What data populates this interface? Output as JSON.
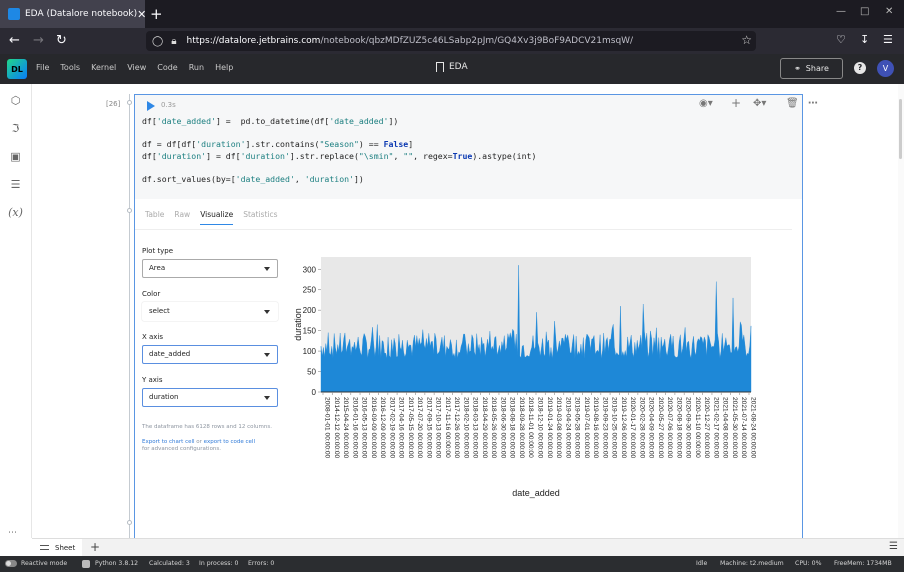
{
  "browser": {
    "tab_title": "EDA (Datalore notebook)",
    "tab_close": "✕",
    "new_tab": "+",
    "url_host": "https://datalore.jetbrains.com",
    "url_path": "/notebook/qbzMDfZUZ5c46LSabp2pJm/GQ4Xv3j9BoF9ADCV21msqW/"
  },
  "app": {
    "logo": "DL",
    "menu": [
      "File",
      "Tools",
      "Kernel",
      "View",
      "Code",
      "Run",
      "Help"
    ],
    "notebook_name": "EDA",
    "share_label": "Share",
    "help": "?",
    "avatar": "V"
  },
  "cell": {
    "number": "[26]",
    "runtime": "0.3s",
    "code": [
      [
        {
          "t": "df["
        },
        {
          "t": "'date_added'",
          "c": "s"
        },
        {
          "t": "] =  pd.to_datetime(df["
        },
        {
          "t": "'date_added'",
          "c": "s"
        },
        {
          "t": "])"
        }
      ],
      [],
      [
        {
          "t": "df = df[df["
        },
        {
          "t": "'duration'",
          "c": "s"
        },
        {
          "t": "].str.contains("
        },
        {
          "t": "\"Season\"",
          "c": "s"
        },
        {
          "t": ") == "
        },
        {
          "t": "False",
          "c": "k"
        },
        {
          "t": "]"
        }
      ],
      [
        {
          "t": "df["
        },
        {
          "t": "'duration'",
          "c": "s"
        },
        {
          "t": "] = df["
        },
        {
          "t": "'duration'",
          "c": "s"
        },
        {
          "t": "].str.replace("
        },
        {
          "t": "\"\\smin\"",
          "c": "s"
        },
        {
          "t": ", "
        },
        {
          "t": "\"\"",
          "c": "s"
        },
        {
          "t": ", regex="
        },
        {
          "t": "True",
          "c": "k"
        },
        {
          "t": ").astype(int)"
        }
      ],
      [],
      [
        {
          "t": "df.sort_values(by=["
        },
        {
          "t": "'date_added'",
          "c": "s"
        },
        {
          "t": ", "
        },
        {
          "t": "'duration'",
          "c": "s"
        },
        {
          "t": "])"
        }
      ]
    ]
  },
  "output": {
    "tabs": [
      "Table",
      "Raw",
      "Visualize",
      "Statistics"
    ],
    "active_tab": "Visualize",
    "plot_type_label": "Plot type",
    "plot_type": "Area",
    "color_label": "Color",
    "color": "select",
    "x_axis_label": "X axis",
    "x_axis": "date_added",
    "y_axis_label": "Y axis",
    "y_axis": "duration",
    "df_info": "The dataframe has 6128 rows and 12 columns.",
    "export_chart": "Export to chart cell",
    "export_or": " or ",
    "export_code": "export to code cell",
    "export_suffix": "for advanced configurations."
  },
  "chart_data": {
    "type": "area",
    "xlabel": "date_added",
    "ylabel": "duration",
    "ylim": [
      0,
      330
    ],
    "yticks": [
      0,
      50,
      100,
      150,
      200,
      250,
      300
    ],
    "color": "#1e88d7",
    "background": "#e8e8e8",
    "xticks": [
      "2008-01-01 00:00:00",
      "2014-12-12 00:00:00",
      "2015-04-24 00:00:00",
      "2016-01-16 00:00:00",
      "2016-05-13 00:00:00",
      "2016-09-09 00:00:00",
      "2016-12-09 00:00:00",
      "2017-02-19 00:00:00",
      "2017-04-16 00:00:00",
      "2017-05-15 00:00:00",
      "2017-07-20 00:00:00",
      "2017-09-15 00:00:00",
      "2017-10-13 00:00:00",
      "2017-11-16 00:00:00",
      "2017-12-26 00:00:00",
      "2018-02-10 00:00:00",
      "2018-03-13 00:00:00",
      "2018-04-29 00:00:00",
      "2018-05-26 00:00:00",
      "2018-06-30 00:00:00",
      "2018-08-18 00:00:00",
      "2018-09-28 00:00:00",
      "2018-11-01 00:00:00",
      "2018-12-10 00:00:00",
      "2019-01-24 00:00:00",
      "2019-03-08 00:00:00",
      "2019-04-24 00:00:00",
      "2019-05-28 00:00:00",
      "2019-07-01 00:00:00",
      "2019-08-16 00:00:00",
      "2019-09-23 00:00:00",
      "2019-10-25 00:00:00",
      "2019-12-06 00:00:00",
      "2020-01-17 00:00:00",
      "2020-02-28 00:00:00",
      "2020-04-09 00:00:00",
      "2020-05-27 00:00:00",
      "2020-07-06 00:00:00",
      "2020-08-18 00:00:00",
      "2020-09-30 00:00:00",
      "2020-11-10 00:00:00",
      "2020-12-27 00:00:00",
      "2021-02-17 00:00:00",
      "2021-04-08 00:00:00",
      "2021-05-30 00:00:00",
      "2021-07-14 00:00:00",
      "2021-08-24 00:00:00"
    ],
    "n_points": 360,
    "typical_range": [
      80,
      145
    ],
    "peaks": [
      {
        "at": 0.459,
        "value": 310
      },
      {
        "at": 0.749,
        "value": 215
      },
      {
        "at": 0.918,
        "value": 270
      },
      {
        "at": 0.957,
        "value": 230
      },
      {
        "at": 0.695,
        "value": 210
      },
      {
        "at": 0.5,
        "value": 195
      },
      {
        "at": 0.13,
        "value": 165
      }
    ]
  },
  "sheet_tabs": {
    "sheet": "Sheet",
    "add": "+"
  },
  "statusbar": {
    "reactive": "Reactive mode",
    "python": "Python 3.8.12",
    "calculated": "Calculated: 3",
    "in_process": "In process: 0",
    "errors": "Errors: 0",
    "idle": "Idle",
    "machine": "Machine: t2.medium",
    "cpu": "CPU:   0%",
    "freemem": "FreeMem:   1734MB"
  }
}
